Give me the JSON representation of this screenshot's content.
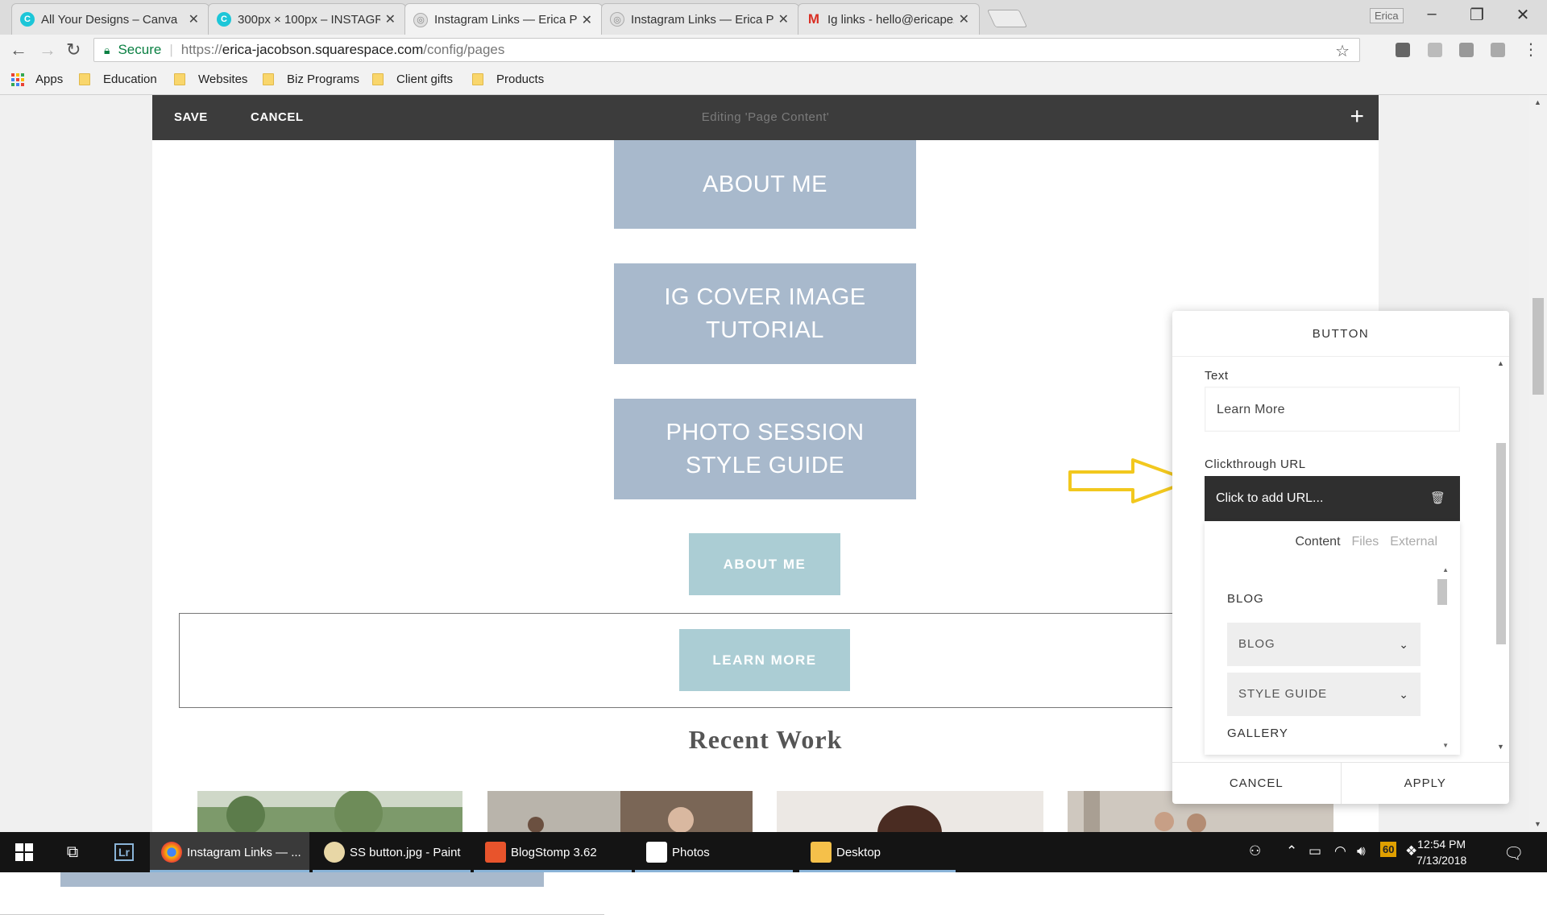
{
  "browser": {
    "tabs": [
      {
        "label": "All Your Designs – Canva",
        "favicon": "canva-icon"
      },
      {
        "label": "300px × 100px – INSTAGR",
        "favicon": "canva-icon"
      },
      {
        "label": "Instagram Links — Erica P",
        "favicon": "squarespace-icon",
        "active": true
      },
      {
        "label": "Instagram Links — Erica P",
        "favicon": "squarespace-icon"
      },
      {
        "label": "Ig links - hello@ericapez",
        "favicon": "gmail-icon"
      }
    ],
    "profile": "Erica",
    "address": {
      "secure_label": "Secure",
      "url_scheme": "https://",
      "url_host": "erica-jacobson.squarespace.com",
      "url_path": "/config/pages"
    },
    "bookmarks": [
      "Apps",
      "Education",
      "Websites",
      "Biz Programs",
      "Client gifts",
      "Products"
    ]
  },
  "editor": {
    "save_label": "SAVE",
    "cancel_label": "CANCEL",
    "title": "Editing 'Page Content'",
    "blocks": {
      "about_me": "ABOUT ME",
      "ig_cover": "IG COVER IMAGE TUTORIAL",
      "photo_session": "PHOTO SESSION STYLE GUIDE",
      "about_me_small": "ABOUT ME",
      "learn_more": "LEARN MORE"
    },
    "recent_work": "Recent Work",
    "colors": {
      "large_button": "#a8b9cc",
      "small_button": "#abcdd4",
      "editbar": "#3c3c3c",
      "arrow": "#f2c81e"
    }
  },
  "panel": {
    "title": "BUTTON",
    "text_label": "Text",
    "text_value": "Learn More",
    "url_label": "Clickthrough URL",
    "url_placeholder": "Click to add URL...",
    "url_tabs": [
      "Content",
      "Files",
      "External"
    ],
    "sections": [
      {
        "heading": "BLOG",
        "items": [
          "BLOG",
          "STYLE GUIDE"
        ]
      },
      {
        "heading": "GALLERY",
        "items": []
      }
    ],
    "cancel_label": "CANCEL",
    "apply_label": "APPLY"
  },
  "taskbar": {
    "apps": [
      {
        "label": "Instagram Links — ...",
        "active": true
      },
      {
        "label": "SS button.jpg - Paint"
      },
      {
        "label": "BlogStomp 3.62"
      },
      {
        "label": "Photos"
      },
      {
        "label": "Desktop"
      }
    ],
    "tray_badge": "60",
    "time": "12:54 PM",
    "date": "7/13/2018"
  }
}
